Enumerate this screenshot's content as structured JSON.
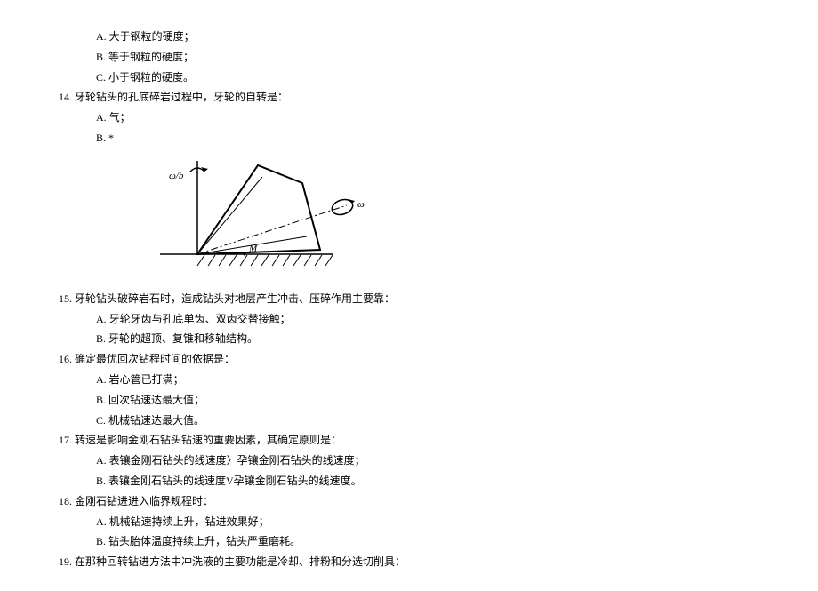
{
  "q13_options": {
    "A": "A.  大于钢粒的硬度；",
    "B": "B.  等于钢粒的硬度；",
    "C": "C.  小于钢粒的硬度。"
  },
  "q14": {
    "text": "14. 牙轮钻头的孔底碎岩过程中，牙轮的自转是：",
    "A": "A.  气；",
    "B": "B.  *"
  },
  "diagram": {
    "label_omega_b": "ω/b",
    "label_omega": "ω",
    "label_M": "M"
  },
  "q15": {
    "text": "15. 牙轮钻头破碎岩石时，造成钻头对地层产生冲击、压碎作用主要靠：",
    "A": "A.  牙轮牙齿与孔底单齿、双齿交替接触；",
    "B": "B.  牙轮的超顶、复锥和移轴结构。"
  },
  "q16": {
    "text": "16. 确定最优回次钻程时间的依据是：",
    "A": "A.  岩心管已打满；",
    "B": "B.  回次钻速达最大值；",
    "C": "C.  机械钻速达最大值。"
  },
  "q17": {
    "text": "17. 转速是影响金刚石钻头钻速的重要因素，其确定原则是：",
    "A": "A.  表镶金刚石钻头的线速度〉孕镶金刚石钻头的线速度；",
    "B": "B.  表镶金刚石钻头的线速度V孕镶金刚石钻头的线速度。"
  },
  "q18": {
    "text": "18. 金刚石钻进进入临界规程时：",
    "A": "A.  机械钻速持续上升，钻进效果好；",
    "B": "B.  钻头胎体温度持续上升，钻头严重磨耗。"
  },
  "q19": {
    "text": "19. 在那种回转钻进方法中冲洗液的主要功能是冷却、排粉和分选切削具："
  }
}
